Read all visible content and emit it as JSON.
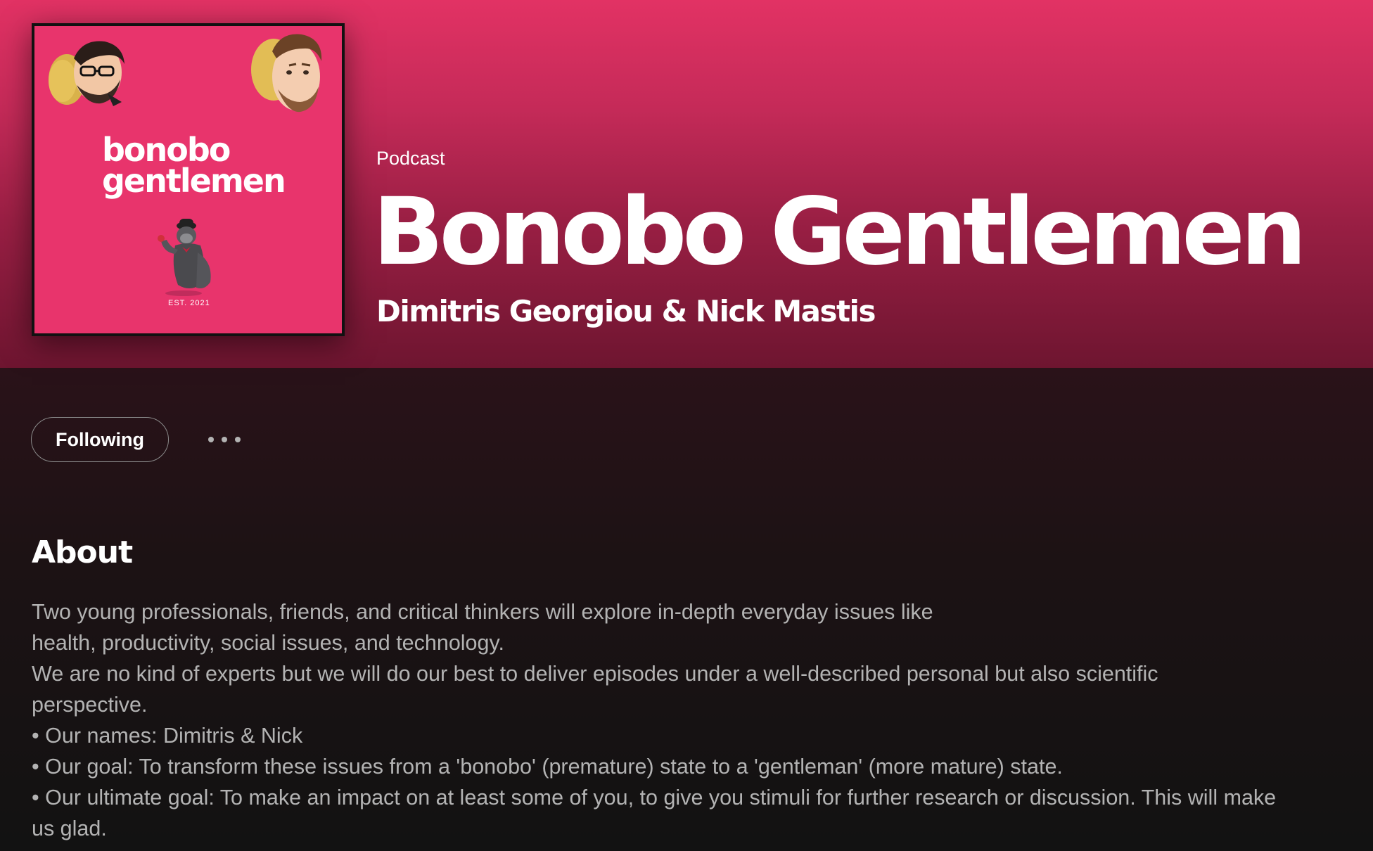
{
  "cover": {
    "title_line1": "bonobo",
    "title_line2": "gentlemen",
    "est": "EST. 2021",
    "background_color": "#e8346c"
  },
  "header": {
    "kind": "Podcast",
    "title": "Bonobo Gentlemen",
    "authors": "Dimitris Georgiou & Nick Mastis",
    "gradient_color": "#e23264"
  },
  "actions": {
    "follow_label": "Following",
    "more_icon": "ellipsis-icon"
  },
  "about": {
    "heading": "About",
    "lines": [
      "Two young professionals, friends, and critical thinkers will explore in-depth everyday issues like",
      "health, productivity, social issues, and technology.",
      "We are no kind of experts but we will do our best to deliver episodes under a well-described personal but also scientific",
      "perspective.",
      "• Our names: Dimitris & Nick",
      "• Our goal: To transform these issues from a 'bonobo' (premature) state to a 'gentleman' (more mature) state.",
      "• Our ultimate goal: To make an impact on at least some of you, to give you stimuli for further research or discussion. This will make",
      "us glad."
    ]
  }
}
